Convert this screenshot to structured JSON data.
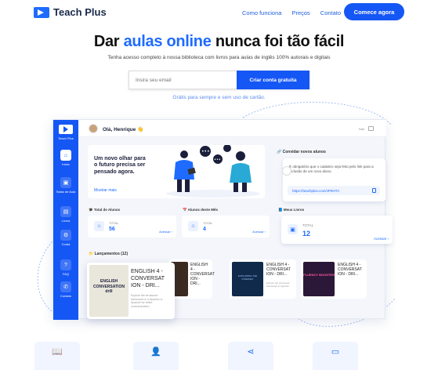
{
  "nav": {
    "brand": "Teach Plus",
    "links": [
      "Como funciona",
      "Preços",
      "Contato"
    ],
    "cta": "Comece agora"
  },
  "hero": {
    "title_before": "Dar ",
    "title_accent": "aulas online",
    "title_after": " nunca foi tão fácil",
    "subtitle": "Tenha acesso completo à nossa biblioteca com livros para aulas de inglês 100% autorais e digitais",
    "email_placeholder": "Insira seu email",
    "submit": "Criar conta gratuita",
    "note": "Grátis para sempre e sem uso de cartão."
  },
  "dashboard": {
    "sidebar": {
      "brand": "Teach Plus",
      "items": [
        {
          "label": "Início",
          "icon": "home-icon",
          "glyph": "⌂"
        },
        {
          "label": "Salas de Aula",
          "icon": "classroom-icon",
          "glyph": "▣"
        },
        {
          "label": "Livros",
          "icon": "book-icon",
          "glyph": "▤"
        },
        {
          "label": "Conta",
          "icon": "gear-icon",
          "glyph": "⚙"
        },
        {
          "label": "FAQ",
          "icon": "help-icon",
          "glyph": "?"
        },
        {
          "label": "Contato",
          "icon": "phone-icon",
          "glyph": "✆"
        }
      ]
    },
    "header": {
      "greeting": "Olá, Henrique 👋",
      "exit": "Sair"
    },
    "banner": {
      "text": "Um novo olhar para o futuro precisa ser pensado agora.",
      "link": "Mostrar mais"
    },
    "invite": {
      "title": "🔗 Convidar novos alunos",
      "text": "É obrigatório que o cadastro seja feito pelo link para a inclusão de um novo aluno.",
      "link": "https://teachplus.com/JP9HTA"
    },
    "stats": [
      {
        "label": "🎓 Total de Alunos",
        "small": "TOTAL",
        "value": "56",
        "link": "Acessar ›"
      },
      {
        "label": "📅 Alunos deste Mês",
        "small": "TOTAL",
        "value": "4",
        "link": "Acessar ›"
      },
      {
        "label": "📘 Meus Livros",
        "small": "TOTAL",
        "value": "12",
        "link": "Acessar ›"
      }
    ],
    "releases": {
      "title": "📁 Lançamentos (12)",
      "books": [
        {
          "title": "ENGLISH 4 - CONVERSAT ION - DRI...",
          "desc": "Explore the structured framework in a Spanish or Spanish for better communication",
          "cover_text": "ENGLISH CONVERSATION drill",
          "color": "#e9e6dc"
        },
        {
          "title": "ENGLISH 4 - CONVERSAT ION - DRI...",
          "desc": "Explore the structured framework in Spanish",
          "cover_text": "",
          "color": "#3a2a20"
        },
        {
          "title": "ENGLISH 4 - CONVERSAT ION - DRI...",
          "desc": "Explore the structured framework in Spanish",
          "cover_text": "EXPLORING THE INTERNET",
          "color": "#0f2a4a"
        },
        {
          "title": "ENGLISH 4 - CONVERSAT ION - DRI...",
          "desc": "",
          "cover_text": "FLUENCY BOOSTER",
          "color": "#2b1838"
        }
      ]
    }
  },
  "features": [
    {
      "icon": "open-book-icon",
      "glyph": "📖"
    },
    {
      "icon": "add-user-icon",
      "glyph": "👤"
    },
    {
      "icon": "share-icon",
      "glyph": "⋖"
    },
    {
      "icon": "presentation-icon",
      "glyph": "▭"
    }
  ]
}
